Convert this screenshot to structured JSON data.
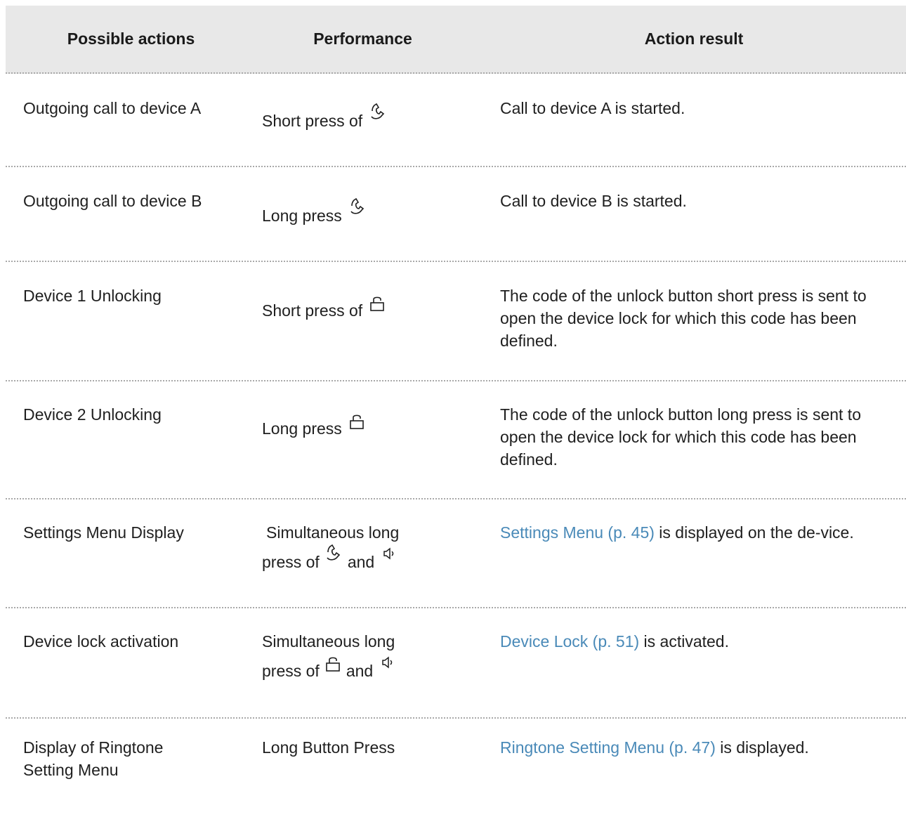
{
  "headers": {
    "col1": "Possible actions",
    "col2": "Performance",
    "col3": "Action result"
  },
  "icons": {
    "phone": "phone-handset-icon",
    "lock": "padlock-icon",
    "speaker": "speaker-icon"
  },
  "colors": {
    "header_bg": "#e8e8e8",
    "link": "#4a8ab8",
    "divider": "#a9a9a9"
  },
  "rows": [
    {
      "action": "Outgoing call to device A",
      "performance": "Short press of",
      "result": "Call to device A is started."
    },
    {
      "action": "Outgoing call to device B",
      "performance": "Long press",
      "result": "Call to device B is started."
    },
    {
      "action": "Device 1 Unlocking",
      "performance": "Short press of",
      "result": "The code of the unlock button short press is sent to open the device lock for which this code has been defined."
    },
    {
      "action": "Device 2 Unlocking",
      "performance": "Long press",
      "result": "The code of the unlock button long press is sent to open the device lock for which this code has been defined."
    },
    {
      "action": "Settings Menu Display",
      "performance_line1": "Simultaneous long",
      "performance_line2a": "press of",
      "performance_line2b": "and",
      "result_link": "Settings Menu (p. 45)",
      "result_text": " is displayed on the de-vice."
    },
    {
      "action": "Device lock activation",
      "performance_line1": "Simultaneous long",
      "performance_line2a": "press of",
      "performance_line2b": "and",
      "result_link": "Device Lock (p. 51)",
      "result_text": " is activated."
    },
    {
      "action": "Display of Ringtone Setting Menu",
      "performance": "Long Button Press",
      "result_link": "Ringtone Setting Menu (p. 47)",
      "result_text": " is displayed."
    }
  ]
}
